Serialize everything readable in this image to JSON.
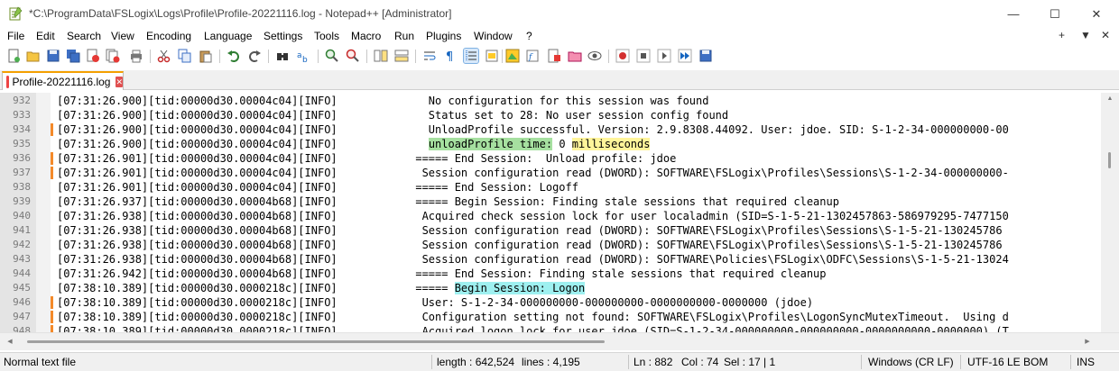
{
  "window": {
    "title": "*C:\\ProgramData\\FSLogix\\Logs\\Profile\\Profile-20221116.log - Notepad++ [Administrator]",
    "minimize_icon": "—",
    "maximize_icon": "☐",
    "close_icon": "✕"
  },
  "menu": {
    "items": [
      "File",
      "Edit",
      "Search",
      "View",
      "Encoding",
      "Language",
      "Settings",
      "Tools",
      "Macro",
      "Run",
      "Plugins",
      "Window",
      "?"
    ],
    "right": [
      "+",
      "▼",
      "✕"
    ]
  },
  "toolbar": {
    "icons": [
      "new-file-icon",
      "open-file-icon",
      "save-icon",
      "save-all-icon",
      "close-icon",
      "close-all-icon",
      "print-icon",
      "cut-icon",
      "copy-icon",
      "paste-icon",
      "undo-icon",
      "redo-icon",
      "find-icon",
      "replace-icon",
      "zoom-in-icon",
      "zoom-out-icon",
      "sync-vertical-icon",
      "sync-horizontal-icon",
      "word-wrap-icon",
      "show-all-chars-icon",
      "indent-guide-icon",
      "language-udl-icon",
      "doc-map-icon",
      "function-list-icon",
      "folder-workspace-icon",
      "monitoring-icon",
      "record-macro-icon",
      "stop-macro-icon",
      "play-macro-icon",
      "run-macro-multiple-icon",
      "save-macro-icon"
    ]
  },
  "tab": {
    "label": "Profile-20221116.log",
    "close_icon": "✕"
  },
  "editor": {
    "lines": [
      {
        "n": "932",
        "changed": false,
        "text": "[07:31:26.900][tid:00000d30.00004c04][INFO]              No configuration for this session was found"
      },
      {
        "n": "933",
        "changed": false,
        "text": "[07:31:26.900][tid:00000d30.00004c04][INFO]              Status set to 28: No user session config found"
      },
      {
        "n": "934",
        "changed": true,
        "text": "[07:31:26.900][tid:00000d30.00004c04][INFO]              UnloadProfile successful. Version: 2.9.8308.44092. User: jdoe. SID: S-1-2-34-000000000-00"
      },
      {
        "n": "935",
        "changed": false,
        "text_a": "[07:31:26.900][tid:00000d30.00004c04][INFO]              ",
        "hl_green": "unloadProfile time:",
        "text_b": " 0 ",
        "hl_yellow": "milliseconds"
      },
      {
        "n": "936",
        "changed": true,
        "text": "[07:31:26.901][tid:00000d30.00004c04][INFO]            ===== End Session:  Unload profile: jdoe"
      },
      {
        "n": "937",
        "changed": true,
        "text": "[07:31:26.901][tid:00000d30.00004c04][INFO]             Session configuration read (DWORD): SOFTWARE\\FSLogix\\Profiles\\Sessions\\S-1-2-34-000000000-"
      },
      {
        "n": "938",
        "changed": false,
        "text": "[07:31:26.901][tid:00000d30.00004c04][INFO]            ===== End Session: Logoff"
      },
      {
        "n": "939",
        "changed": false,
        "text": "[07:31:26.937][tid:00000d30.00004b68][INFO]            ===== Begin Session: Finding stale sessions that required cleanup"
      },
      {
        "n": "940",
        "changed": false,
        "text": "[07:31:26.938][tid:00000d30.00004b68][INFO]             Acquired check session lock for user localadmin (SID=S-1-5-21-1302457863-586979295-7477150"
      },
      {
        "n": "941",
        "changed": false,
        "text": "[07:31:26.938][tid:00000d30.00004b68][INFO]             Session configuration read (DWORD): SOFTWARE\\FSLogix\\Profiles\\Sessions\\S-1-5-21-130245786"
      },
      {
        "n": "942",
        "changed": false,
        "text": "[07:31:26.938][tid:00000d30.00004b68][INFO]             Session configuration read (DWORD): SOFTWARE\\FSLogix\\Profiles\\Sessions\\S-1-5-21-130245786"
      },
      {
        "n": "943",
        "changed": false,
        "text": "[07:31:26.938][tid:00000d30.00004b68][INFO]             Session configuration read (DWORD): SOFTWARE\\Policies\\FSLogix\\ODFC\\Sessions\\S-1-5-21-13024"
      },
      {
        "n": "944",
        "changed": false,
        "text": "[07:31:26.942][tid:00000d30.00004b68][INFO]            ===== End Session: Finding stale sessions that required cleanup"
      },
      {
        "n": "945",
        "changed": false,
        "text_a": "[07:38:10.389][tid:00000d30.0000218c][INFO]            ===== ",
        "hl_cyan": "Begin Session: Logon"
      },
      {
        "n": "946",
        "changed": true,
        "text": "[07:38:10.389][tid:00000d30.0000218c][INFO]             User: S-1-2-34-000000000-000000000-0000000000-0000000 (jdoe)"
      },
      {
        "n": "947",
        "changed": true,
        "text": "[07:38:10.389][tid:00000d30.0000218c][INFO]             Configuration setting not found: SOFTWARE\\FSLogix\\Profiles\\LogonSyncMutexTimeout.  Using d"
      },
      {
        "n": "948",
        "changed": true,
        "text": "[07:38:10.389][tid:00000d30.0000218c][INFO]             Acquired logon lock for user jdoe (SID=S-1-2-34-000000000-000000000-0000000000-0000000) (T"
      }
    ]
  },
  "statusbar": {
    "file_type": "Normal text file",
    "length": "length : 642,524",
    "lines": "lines : 4,195",
    "ln": "Ln : 882",
    "col": "Col : 74",
    "sel": "Sel : 17 | 1",
    "eol": "Windows (CR LF)",
    "encoding": "UTF-16 LE BOM",
    "mode": "INS"
  }
}
